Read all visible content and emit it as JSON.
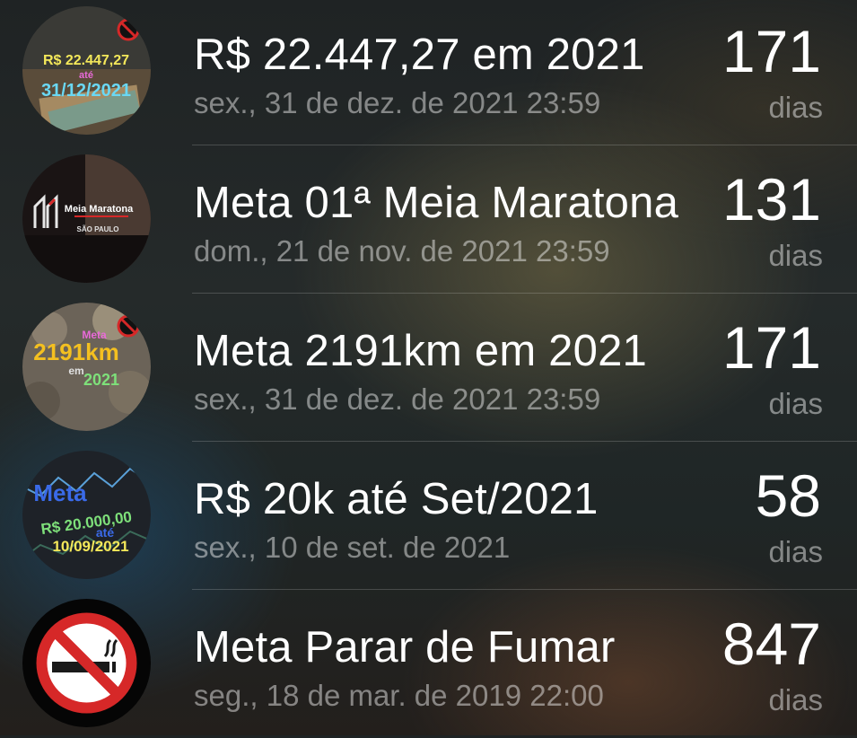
{
  "goals": [
    {
      "title": "R$ 22.447,27 em 2021",
      "date": "sex., 31 de dez. de 2021 23:59",
      "count": "171",
      "unit": "dias",
      "thumb": {
        "icon": "money-goal-image",
        "line1": "R$ 22.447,27",
        "line2": "até",
        "line3": "31/12/2021"
      }
    },
    {
      "title": "Meta 01ª Meia Maratona",
      "date": "dom., 21 de nov. de 2021 23:59",
      "count": "131",
      "unit": "dias",
      "thumb": {
        "icon": "half-marathon-image",
        "line1": "Meia Maratona",
        "line2": "SÃO PAULO"
      }
    },
    {
      "title": "Meta 2191km em 2021",
      "date": "sex., 31 de dez. de 2021 23:59",
      "count": "171",
      "unit": "dias",
      "thumb": {
        "icon": "km-goal-image",
        "line1": "Meta",
        "line2": "2191km",
        "line3": "em",
        "line4": "2021"
      }
    },
    {
      "title": "R$ 20k até Set/2021",
      "date": "sex., 10 de set. de 2021",
      "count": "58",
      "unit": "dias",
      "thumb": {
        "icon": "savings-goal-image",
        "line1": "Meta",
        "line2": "R$ 20.000,00",
        "line3": "até",
        "line4": "10/09/2021"
      }
    },
    {
      "title": "Meta Parar de Fumar",
      "date": "seg., 18 de mar. de 2019 22:00",
      "count": "847",
      "unit": "dias",
      "thumb": {
        "icon": "no-smoking-icon"
      }
    }
  ],
  "colors": {
    "primary_text": "#ffffff",
    "secondary_text": "#8e8e8e",
    "no_smoking_red": "#d62828"
  }
}
